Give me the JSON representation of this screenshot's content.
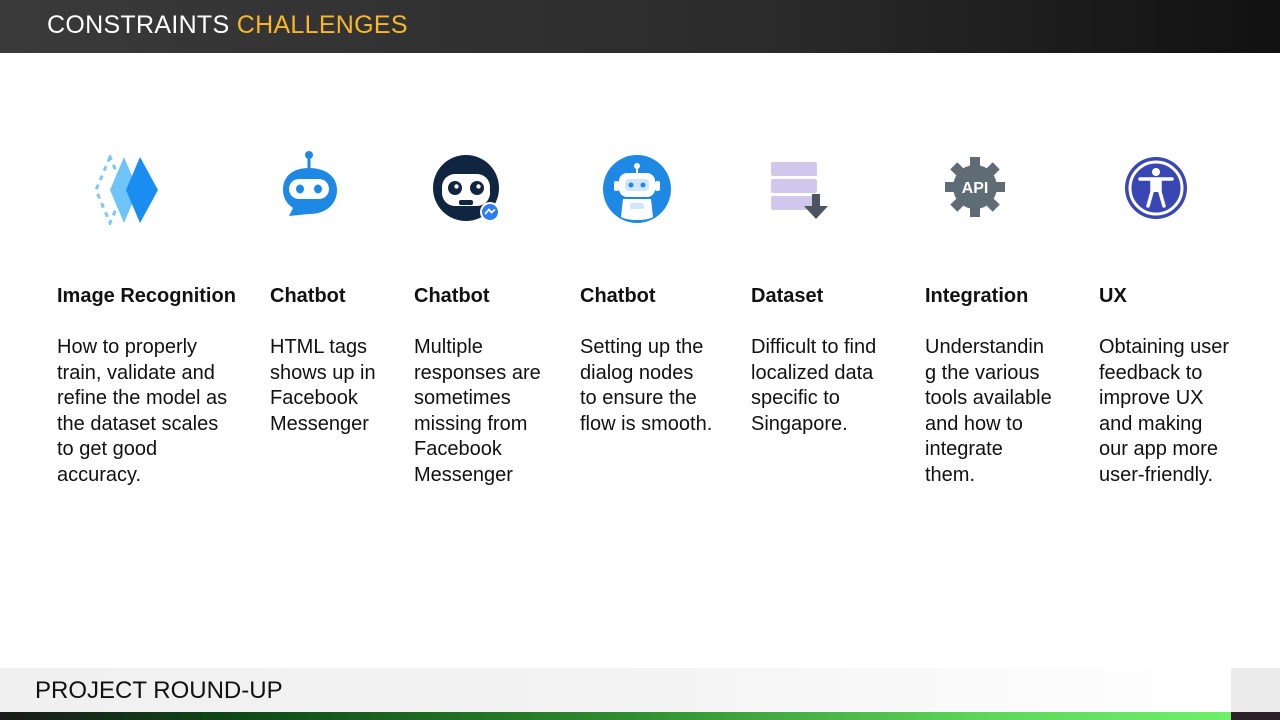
{
  "header": {
    "title_main": "CONSTRAINTS",
    "title_accent": "CHALLENGES"
  },
  "columns": [
    {
      "title": "Image Recognition",
      "body": "How to properly train, validate and refine the model as the dataset scales to get good accuracy.",
      "icon": "image-recognition-diamond-icon"
    },
    {
      "title": "Chatbot",
      "body": "HTML tags shows up in Facebook Messenger",
      "icon": "chatbot-bubble-icon"
    },
    {
      "title": "Chatbot",
      "body": "Multiple responses are sometimes missing from Facebook Messenger",
      "icon": "messenger-bot-icon"
    },
    {
      "title": "Chatbot",
      "body": "Setting up the dialog nodes to ensure the flow is smooth.",
      "icon": "robot-icon"
    },
    {
      "title": "Dataset",
      "body": "Difficult to find localized data specific to Singapore.",
      "icon": "database-download-icon"
    },
    {
      "title": "Integration",
      "body": "Understanding the various tools available and how to integrate them.",
      "icon": "api-gear-icon"
    },
    {
      "title": "UX",
      "body": "Obtaining user feedback to improve UX and making our app more user-friendly.",
      "icon": "accessibility-icon"
    }
  ],
  "footer": {
    "title": "PROJECT ROUND-UP"
  },
  "colors": {
    "accent": "#f7b72c",
    "icon_blue": "#1e88e5",
    "icon_navy": "#0f2540",
    "footer_green": "#5ed65a"
  }
}
